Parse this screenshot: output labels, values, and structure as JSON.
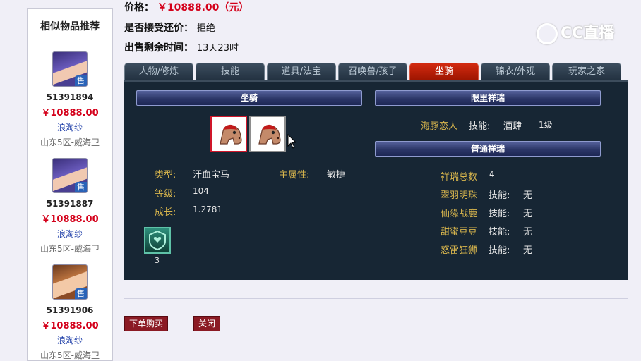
{
  "info": {
    "price_label": "价格：",
    "price_value": "￥10888.00（元）",
    "counter_offer_label": "是否接受还价：",
    "counter_offer_value": "拒绝",
    "time_left_label": "出售剩余时间：",
    "time_left_value": "13天23时"
  },
  "watermark": "CC直播",
  "sidebar": {
    "title": "相似物品推荐",
    "items": [
      {
        "sell_badge": "售",
        "id": "51391894",
        "price": "￥10888.00",
        "seller": "浪淘纱",
        "server": "山东5区-威海卫"
      },
      {
        "sell_badge": "售",
        "id": "51391887",
        "price": "￥10888.00",
        "seller": "浪淘纱",
        "server": "山东5区-威海卫"
      },
      {
        "sell_badge": "售",
        "id": "51391906",
        "price": "￥10888.00",
        "seller": "浪淘纱",
        "server": "山东5区-威海卫"
      }
    ]
  },
  "tabs": [
    "人物/修炼",
    "技能",
    "道具/法宝",
    "召唤兽/孩子",
    "坐骑",
    "锦衣/外观",
    "玩家之家"
  ],
  "active_tab": "坐骑",
  "mount": {
    "header": "坐骑",
    "type_label": "类型:",
    "type_value": "汗血宝马",
    "main_attr_label": "主属性:",
    "main_attr_value": "敏捷",
    "level_label": "等级:",
    "level_value": "104",
    "growth_label": "成长:",
    "growth_value": "1.2781",
    "skill_count": "3"
  },
  "limited": {
    "header": "限里祥瑞",
    "name": "海豚恋人",
    "skill_label": "技能:",
    "skill_value": "酒肆",
    "skill_level": "1级"
  },
  "normal": {
    "header": "普通祥瑞",
    "total_label": "祥瑞总数",
    "total_value": "4",
    "items": [
      {
        "name": "翠羽明珠",
        "skill_label": "技能:",
        "skill_value": "无"
      },
      {
        "name": "仙缘战鹿",
        "skill_label": "技能:",
        "skill_value": "无"
      },
      {
        "name": "甜蜜豆豆",
        "skill_label": "技能:",
        "skill_value": "无"
      },
      {
        "name": "怒雷狂狮",
        "skill_label": "技能:",
        "skill_value": "无"
      }
    ]
  },
  "buttons": {
    "buy": "下单购买",
    "close": "关闭"
  },
  "colors": {
    "price_red": "#d4001a",
    "active_tab": "#c21d06",
    "panel_bg": "#172634",
    "label_gold": "#d9b64d",
    "button_red": "#8b1a24"
  }
}
